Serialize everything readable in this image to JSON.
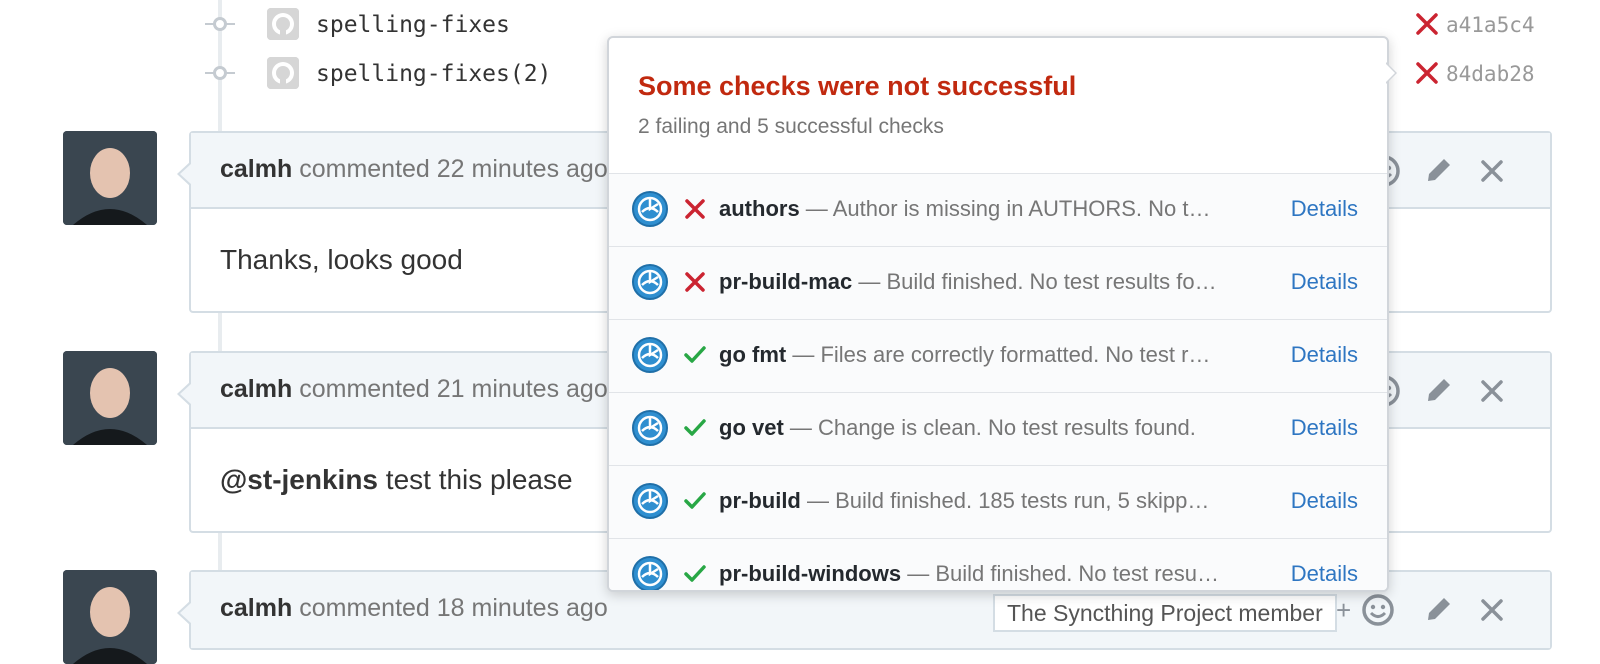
{
  "commits": [
    {
      "message": "spelling-fixes",
      "status": "failure",
      "sha": "a41a5c4"
    },
    {
      "message": "spelling-fixes(2)",
      "status": "failure",
      "sha": "84dab28"
    }
  ],
  "comments": [
    {
      "author": "calmh",
      "meta": "commented 22 minutes ago",
      "body_mention": "",
      "body_text": "Thanks, looks good"
    },
    {
      "author": "calmh",
      "meta": "commented 21 minutes ago",
      "body_mention": "@st-jenkins",
      "body_text": " test this please"
    },
    {
      "author": "calmh",
      "meta": "commented 18 minutes ago",
      "role_badge": "The Syncthing Project member"
    }
  ],
  "actions": {
    "add_reaction": "+",
    "reaction_icon": "smiley-icon",
    "edit_icon": "pencil-icon",
    "delete_icon": "x-icon"
  },
  "popover": {
    "title": "Some checks were not successful",
    "subtitle": "2 failing and 5 successful checks",
    "checks": [
      {
        "name": "authors",
        "sep": " — ",
        "description": "Author is missing in AUTHORS. No t…",
        "status": "failure",
        "link": "Details"
      },
      {
        "name": "pr-build-mac",
        "sep": " — ",
        "description": "Build finished. No test results fo…",
        "status": "failure",
        "link": "Details"
      },
      {
        "name": "go fmt",
        "sep": " — ",
        "description": "Files are correctly formatted. No test r…",
        "status": "success",
        "link": "Details"
      },
      {
        "name": "go vet",
        "sep": " — ",
        "description": "Change is clean. No test results found.",
        "status": "success",
        "link": "Details"
      },
      {
        "name": "pr-build",
        "sep": " — ",
        "description": "Build finished. 185 tests run, 5 skipp…",
        "status": "success",
        "link": "Details"
      },
      {
        "name": "pr-build-windows",
        "sep": " — ",
        "description": "Build finished. No test resu…",
        "status": "success",
        "link": "Details"
      }
    ]
  },
  "colors": {
    "failure": "#cb2431",
    "success": "#28a745",
    "link": "#2e76c2",
    "title_error": "#c1290f"
  }
}
